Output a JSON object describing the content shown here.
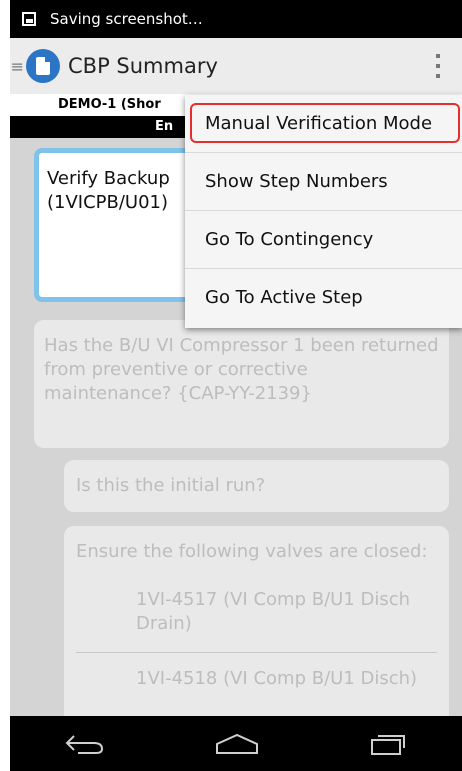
{
  "status_bar": {
    "text": "Saving screenshot…"
  },
  "app_bar": {
    "title": "CBP Summary"
  },
  "header": {
    "line1": "DEMO-1 (Shor",
    "line2": "En"
  },
  "active_step": {
    "text_line1": "Verify Backup",
    "text_line2": "(1VICPB/U01)"
  },
  "steps": [
    {
      "text": "Has the B/U VI Compressor 1 been returned from preventive or corrective maintenance? {CAP-YY-2139}"
    },
    {
      "text": "Is this the initial run?"
    },
    {
      "text": "Ensure the following valves are closed:",
      "items": [
        "1VI-4517 (VI Comp B/U1 Disch Drain)",
        "1VI-4518 (VI Comp B/U1 Disch)"
      ]
    }
  ],
  "menu": {
    "items": [
      "Manual Verification Mode",
      "Show Step Numbers",
      "Go To Contingency",
      "Go To Active Step"
    ]
  },
  "colors": {
    "highlight": "#e3302f",
    "active_border": "#7fc3ea",
    "app_icon": "#2c74c4"
  }
}
